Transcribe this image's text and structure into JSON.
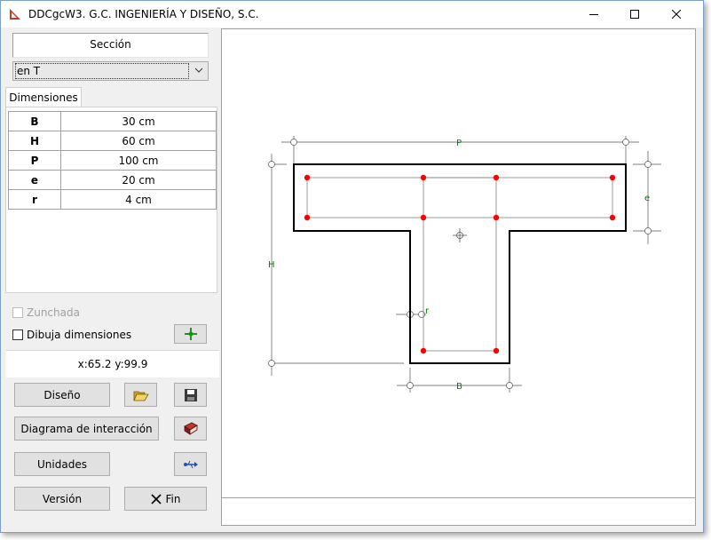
{
  "window": {
    "title": "DDCgcW3. G.C. INGENIERÍA Y DISEÑO, S.C."
  },
  "section": {
    "label": "Sección",
    "selected": "en T"
  },
  "dimensions": {
    "tab_label": "Dimensiones",
    "rows": [
      {
        "key": "B",
        "value": "30 cm"
      },
      {
        "key": "H",
        "value": "60 cm"
      },
      {
        "key": "P",
        "value": "100 cm"
      },
      {
        "key": "e",
        "value": "20 cm"
      },
      {
        "key": "r",
        "value": "4 cm"
      }
    ]
  },
  "options": {
    "zunchada": "Zunchada",
    "dibuja": "Dibuja dimensiones"
  },
  "coords": "x:65.2 y:99.9",
  "buttons": {
    "diseno": "Diseño",
    "diagrama": "Diagrama de interacción",
    "unidades": "Unidades",
    "version": "Versión",
    "fin": "Fin"
  },
  "drawing": {
    "label_p": "P",
    "label_e": "e",
    "label_h": "H",
    "label_r": "r",
    "label_b": "B",
    "dim_color": "#008000",
    "bar_color": "#ff0000"
  }
}
